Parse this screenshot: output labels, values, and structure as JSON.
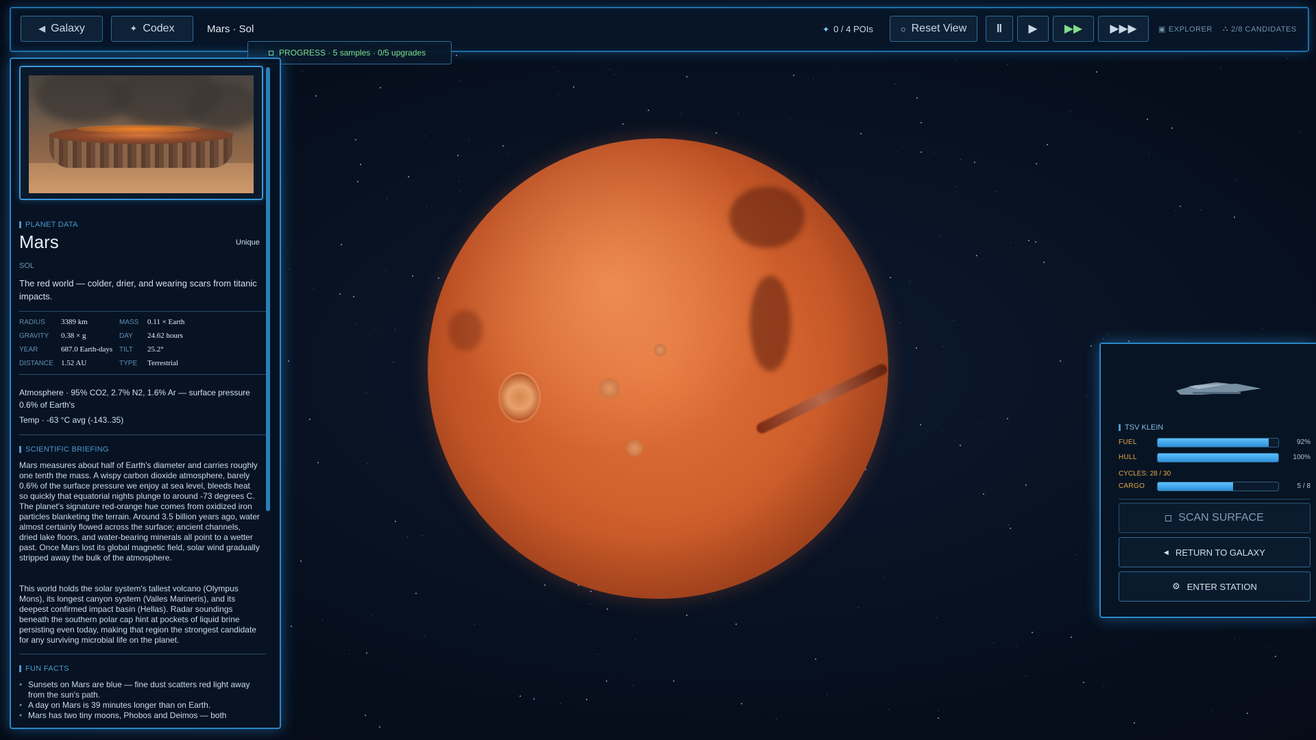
{
  "topbar": {
    "galaxy_label": "Galaxy",
    "codex_label": "Codex",
    "breadcrumb": "Mars · Sol",
    "pois": "0 / 4 POIs",
    "reset_label": "Reset View",
    "pause_glyph": "‖",
    "play_glyph": "▶",
    "fast_glyph": "▶▶",
    "faster_glyph": "▶▶▶",
    "explorer_label": "EXPLORER",
    "candidates_label": "2/8 CANDIDATES"
  },
  "progress": {
    "text": "PROGRESS · 5 samples · 0/5 upgrades"
  },
  "planet": {
    "section_label": "PLANET DATA",
    "name": "Mars",
    "rarity": "Unique",
    "system": "SOL",
    "tagline": "The red world — colder, drier, and wearing scars from titanic impacts.",
    "stats": [
      {
        "label": "RADIUS",
        "value": "3389 km"
      },
      {
        "label": "MASS",
        "value": "0.11 × Earth"
      },
      {
        "label": "GRAVITY",
        "value": "0.38 × g"
      },
      {
        "label": "DAY",
        "value": "24.62 hours"
      },
      {
        "label": "YEAR",
        "value": "687.0 Earth-days"
      },
      {
        "label": "TILT",
        "value": "25.2°"
      },
      {
        "label": "DISTANCE",
        "value": "1.52 AU"
      },
      {
        "label": "TYPE",
        "value": "Terrestrial"
      }
    ],
    "atmosphere": "Atmosphere · 95% CO2, 2.7% N2, 1.6% Ar — surface pressure 0.6% of Earth's",
    "temp": "Temp · -63 °C avg (-143..35)"
  },
  "briefing": {
    "section_label": "SCIENTIFIC BRIEFING",
    "paragraphs": [
      "Mars measures about half of Earth's diameter and carries roughly one tenth the mass. A wispy carbon dioxide atmosphere, barely 0.6% of the surface pressure we enjoy at sea level, bleeds heat so quickly that equatorial nights plunge to around -73 degrees C. The planet's signature red-orange hue comes from oxidized iron particles blanketing the terrain. Around 3.5 billion years ago, water almost certainly flowed across the surface; ancient channels, dried lake floors, and water-bearing minerals all point to a wetter past. Once Mars lost its global magnetic field, solar wind gradually stripped away the bulk of the atmosphere.",
      "This world holds the solar system's tallest volcano (Olympus Mons), its longest canyon system (Valles Marineris), and its deepest confirmed impact basin (Hellas). Radar soundings beneath the southern polar cap hint at pockets of liquid brine persisting even today, making that region the strongest candidate for any surviving microbial life on the planet."
    ]
  },
  "facts": {
    "section_label": "FUN FACTS",
    "items": [
      "Sunsets on Mars are blue — fine dust scatters red light away from the sun's path.",
      "A day on Mars is 39 minutes longer than on Earth.",
      "Mars has two tiny moons, Phobos and Deimos — both"
    ]
  },
  "ship": {
    "name": "TSV KLEIN",
    "gauges": [
      {
        "label": "FUEL",
        "value": "92%",
        "fraction": 0.92
      },
      {
        "label": "HULL",
        "value": "100%",
        "fraction": 1.0
      },
      {
        "label": "CARGO",
        "value": "5 / 8",
        "fraction": 0.625
      }
    ],
    "cycles": "CYCLES: 28 / 30",
    "scan_label": "SCAN SURFACE",
    "return_label": "RETURN TO GALAXY",
    "station_label": "ENTER STATION"
  },
  "colors": {
    "panel_border": "#2a88c8",
    "accent_green": "#7fe08f",
    "gauge_label": "#e2a64a",
    "gauge_fill": "#3aa3ea",
    "planet": "#d0602c"
  }
}
